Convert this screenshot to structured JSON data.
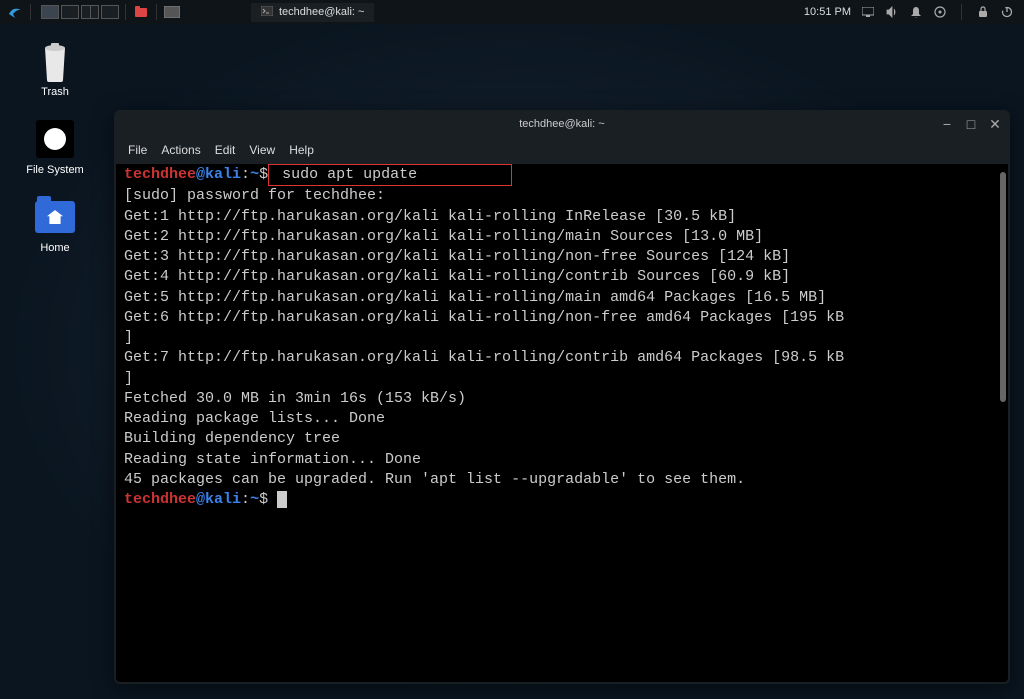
{
  "panel": {
    "clock": "10:51 PM",
    "taskbar_item": "techdhee@kali: ~"
  },
  "desktop_icons": {
    "trash": "Trash",
    "filesystem": "File System",
    "home": "Home"
  },
  "terminal": {
    "title": "techdhee@kali: ~",
    "menu": {
      "file": "File",
      "actions": "Actions",
      "edit": "Edit",
      "view": "View",
      "help": "Help"
    },
    "prompt": {
      "user": "techdhee",
      "host": "kali",
      "path": "~",
      "dollar": "$"
    },
    "command": "sudo apt update",
    "lines": {
      "l1": "[sudo] password for techdhee:",
      "l2": "Get:1 http://ftp.harukasan.org/kali kali-rolling InRelease [30.5 kB]",
      "l3": "Get:2 http://ftp.harukasan.org/kali kali-rolling/main Sources [13.0 MB]",
      "l4": "Get:3 http://ftp.harukasan.org/kali kali-rolling/non-free Sources [124 kB]",
      "l5": "Get:4 http://ftp.harukasan.org/kali kali-rolling/contrib Sources [60.9 kB]",
      "l6": "Get:5 http://ftp.harukasan.org/kali kali-rolling/main amd64 Packages [16.5 MB]",
      "l7": "Get:6 http://ftp.harukasan.org/kali kali-rolling/non-free amd64 Packages [195 kB",
      "l7b": "]",
      "l8": "Get:7 http://ftp.harukasan.org/kali kali-rolling/contrib amd64 Packages [98.5 kB",
      "l8b": "]",
      "l9": "Fetched 30.0 MB in 3min 16s (153 kB/s)",
      "l10": "Reading package lists... Done",
      "l11": "Building dependency tree",
      "l12": "Reading state information... Done",
      "l13": "45 packages can be upgraded. Run 'apt list --upgradable' to see them."
    }
  }
}
